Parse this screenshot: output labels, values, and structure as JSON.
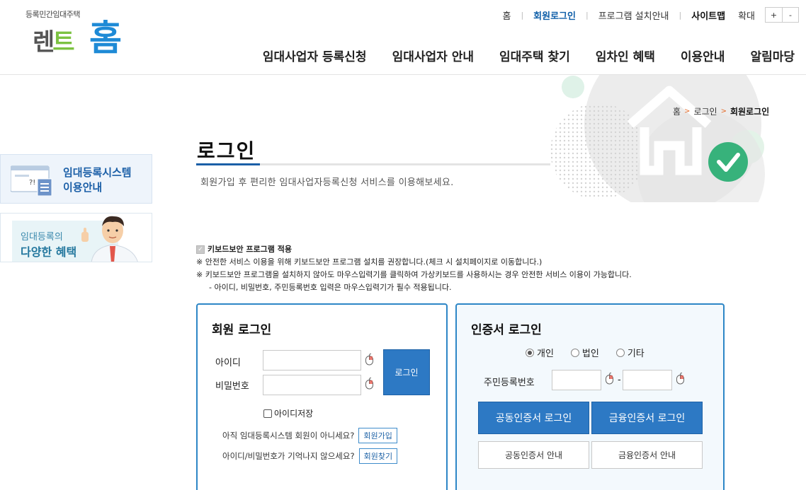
{
  "header": {
    "logo": {
      "subtitle": "등록민간임대주택",
      "rent": "렌",
      "t": "트",
      "home": "홈"
    },
    "util": {
      "home": "홈",
      "member_login": "회원로그인",
      "program_install": "프로그램 설치안내",
      "sitemap": "사이트맵",
      "zoom_label": "확대",
      "zoom_in": "+",
      "zoom_out": "-"
    },
    "nav": [
      "임대사업자 등록신청",
      "임대사업자 안내",
      "임대주택 찾기",
      "임차인 혜택",
      "이용안내",
      "알림마당"
    ]
  },
  "breadcrumb": {
    "home": "홈",
    "sep": ">",
    "login": "로그인",
    "current": "회원로그인"
  },
  "sidebar": {
    "banner1": {
      "line1": "임대등록시스템",
      "line2": "이용안내"
    },
    "banner2": {
      "line1": "임대등록의",
      "line2": "다양한 혜택"
    }
  },
  "page": {
    "title": "로그인",
    "description": "회원가입 후 편리한 임대사업자등록신청 서비스를 이용해보세요."
  },
  "notice": {
    "keyboard_security": "키보드보안 프로그램 적용",
    "line1": "※ 안전한 서비스 이용을 위해 키보드보안 프로그램 설치를 권장합니다.(체크 시 설치페이지로 이동합니다.)",
    "line2": "※ 키보드보안 프로그램을 설치하지 않아도 마우스입력기를 클릭하여 가상키보드를 사용하시는 경우 안전한 서비스 이용이 가능합니다.",
    "line3": "- 아이디, 비밀번호, 주민등록번호 입력은 마우스입력기가 필수 적용됩니다."
  },
  "member_login": {
    "title": "회원 로그인",
    "id_label": "아이디",
    "id_value": "",
    "pw_label": "비밀번호",
    "pw_value": "",
    "login_button": "로그인",
    "save_id": "아이디저장",
    "join_question": "아직 임대등록시스템 회원이 아니세요?",
    "join_button": "회원가입",
    "find_question": "아이디/비밀번호가 기억나지 않으세요?",
    "find_button": "회원찾기"
  },
  "cert_login": {
    "title": "인증서 로그인",
    "radios": {
      "individual": "개인",
      "corporate": "법인",
      "other": "기타",
      "selected": "개인"
    },
    "rrn_label": "주민등록번호",
    "rrn_dash": "-",
    "joint_cert_login": "공동인증서 로그인",
    "financial_cert_login": "금융인증서 로그인",
    "joint_cert_guide": "공동인증서 안내",
    "financial_cert_guide": "금융인증서 안내"
  },
  "colors": {
    "primary": "#2d79c4",
    "border": "#2d86c6",
    "accent": "#1e8ad6",
    "green": "#7cc242",
    "breadcrumb_arrow": "#e36a27"
  }
}
